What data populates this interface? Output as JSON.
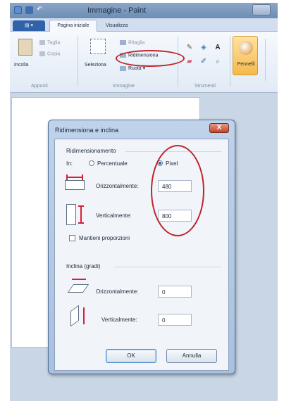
{
  "window": {
    "title": "Immagine - Paint"
  },
  "ribbon": {
    "file_tab": "",
    "tabs": [
      {
        "label": "Pagina iniziale"
      },
      {
        "label": "Visualizza"
      }
    ],
    "clipboard": {
      "paste": "Incolla",
      "cut": "Taglia",
      "copy": "Copia",
      "group": "Appunti"
    },
    "image": {
      "select": "Seleziona",
      "crop": "Ritaglia",
      "resize": "Ridimensiona",
      "rotate": "Ruota",
      "group": "Immagine"
    },
    "tools": {
      "group": "Strumenti",
      "text_tool": "A"
    },
    "brushes": {
      "label": "Pennelli"
    }
  },
  "dialog": {
    "title": "Ridimensiona e inclina",
    "close": "X",
    "resize": {
      "heading": "Ridimensionamento",
      "by_label": "In:",
      "option_percent": "Percentuale",
      "option_pixel": "Pixel",
      "selected": "pixel",
      "horizontal_label": "Orizzontalmente:",
      "horizontal_value": "480",
      "vertical_label": "Verticalmente:",
      "vertical_value": "800",
      "keep_ratio_label": "Mantieni proporzioni",
      "keep_ratio_checked": false
    },
    "skew": {
      "heading": "Inclina (gradi)",
      "horizontal_label": "Orizzontalmente:",
      "horizontal_value": "0",
      "vertical_label": "Verticalmente:",
      "vertical_value": "0"
    },
    "ok": "OK",
    "cancel": "Annulla"
  },
  "icons": {
    "paste": "clipboard-icon",
    "cut": "scissors-icon",
    "copy": "copy-icon",
    "crop": "crop-icon",
    "resize": "resize-icon",
    "rotate": "rotate-icon",
    "pencil": "pencil-icon",
    "fill": "bucket-icon",
    "text": "text-icon",
    "eraser": "eraser-icon",
    "picker": "color-picker-icon",
    "magnifier": "magnifier-icon",
    "brush": "brush-icon"
  },
  "colors": {
    "annotation_ring": "#c0232c",
    "accent": "#2b63b3",
    "close_button": "#c2452b"
  }
}
